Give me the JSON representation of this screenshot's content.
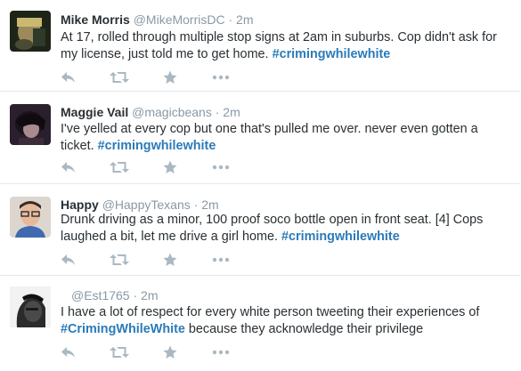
{
  "tweets": [
    {
      "name": "Mike Morris",
      "handle": "@MikeMorrisDC",
      "dot": "·",
      "time": "2m",
      "text": "At 17, rolled through multiple stop signs at 2am in suburbs. Cop didn't ask for my license, just told me to get home.",
      "hashtag": "#crimingwhilewhite",
      "text_after": ""
    },
    {
      "name": "Maggie Vail",
      "handle": "@magicbeans",
      "dot": "·",
      "time": "2m",
      "text": "I've yelled at every cop but one that's pulled me over. never even gotten a ticket.",
      "hashtag": "#crimingwhilewhite",
      "text_after": ""
    },
    {
      "name": "Happy",
      "handle": "@HappyTexans",
      "dot": "·",
      "time": "2m",
      "text": "Drunk driving as a minor, 100 proof soco bottle open in front seat. [4] Cops laughed a bit, let me drive a girl home.",
      "hashtag": "#crimingwhilewhite",
      "text_after": ""
    },
    {
      "name": "",
      "handle": "@Est1765",
      "dot": "·",
      "time": "2m",
      "text": "I have a lot of respect for every white person tweeting their experiences of",
      "hashtag": "#CrimingWhileWhite",
      "text_after": "because they acknowledge their privilege"
    }
  ],
  "icons": {
    "reply": "reply-icon",
    "retweet": "retweet-icon",
    "favorite": "star-icon",
    "more": "more-icon"
  },
  "colors": {
    "text": "#292f33",
    "muted": "#8899a6",
    "hashtag": "#2b7bb9",
    "icon": "#aab8c2",
    "divider": "#e1e8ed"
  }
}
